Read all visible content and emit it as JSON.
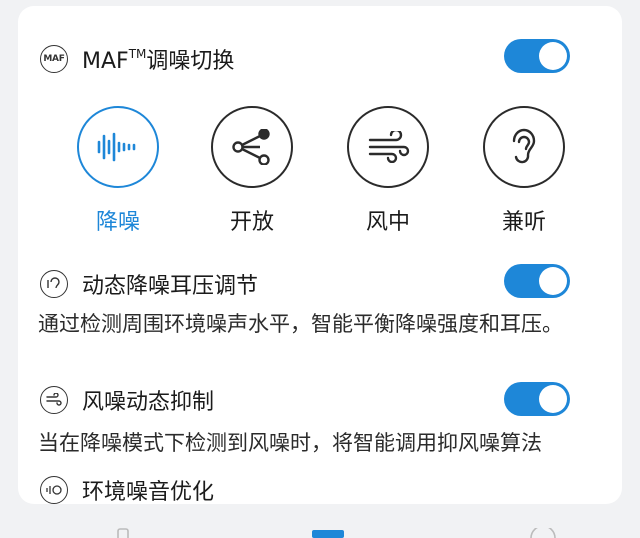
{
  "maf": {
    "icon_text": "MAF",
    "title_prefix": "MAF",
    "title_sup": "TM",
    "title_suffix": "调噪切换",
    "enabled": true
  },
  "modes": [
    {
      "label": "降噪",
      "icon": "noise-cancel-waveform-icon",
      "active": true
    },
    {
      "label": "开放",
      "icon": "share-nodes-icon",
      "active": false
    },
    {
      "label": "风中",
      "icon": "wind-icon",
      "active": false
    },
    {
      "label": "兼听",
      "icon": "ear-icon",
      "active": false
    }
  ],
  "settings": [
    {
      "title": "动态降噪耳压调节",
      "description": "通过检测周围环境噪声水平，智能平衡降噪强度和耳压。",
      "enabled": true,
      "icon": "ear-pressure-icon"
    },
    {
      "title": "风噪动态抑制",
      "description": "当在降噪模式下检测到风噪时，将智能调用抑风噪算法",
      "enabled": true,
      "icon": "wind-suppress-icon"
    },
    {
      "title": "环境噪音优化",
      "icon": "ambient-noise-icon"
    }
  ],
  "colors": {
    "accent": "#1e87d8",
    "text": "#1b1b1b",
    "background": "#f1f2f4",
    "card": "#ffffff"
  }
}
